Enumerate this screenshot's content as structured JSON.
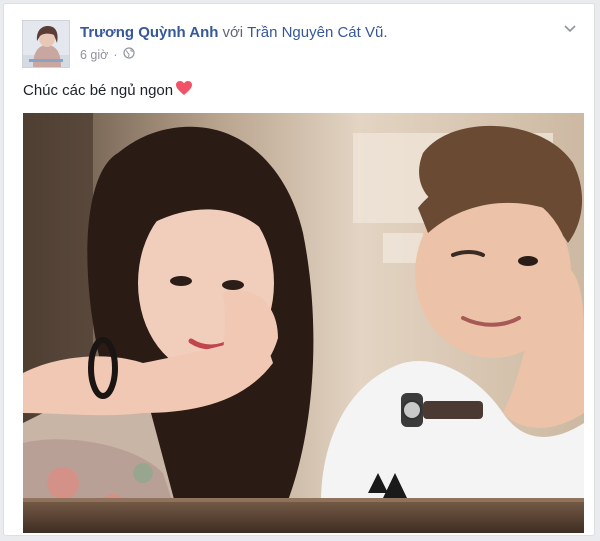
{
  "post": {
    "author_name": "Trương Quỳnh Anh",
    "with_text": "với",
    "tagged_name": "Trần Nguyên Cát Vũ.",
    "timestamp": "6 giờ",
    "separator": "·",
    "audience_icon": "globe-icon",
    "status_text": "Chúc các bé ngủ ngon",
    "status_emoji": "heart-emoji",
    "options_icon": "chevron-down-icon"
  },
  "colors": {
    "link": "#365899",
    "meta": "#90949c",
    "heart": "#f25268",
    "card_border": "#dddfe2"
  }
}
